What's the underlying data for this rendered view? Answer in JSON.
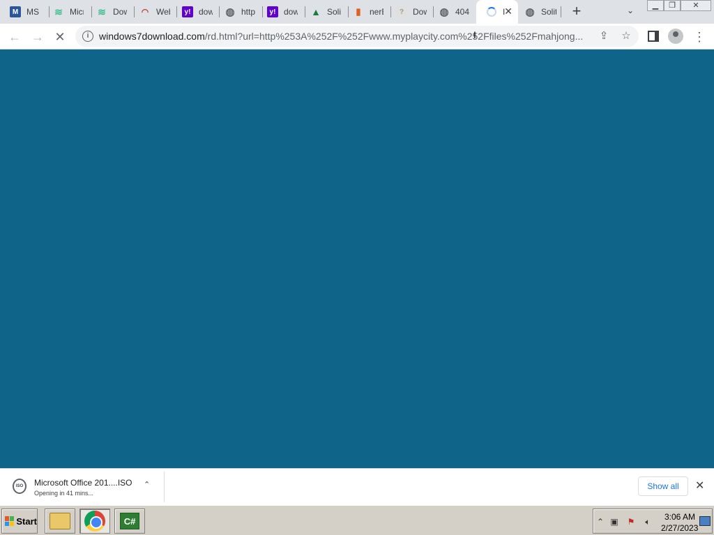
{
  "tabs": [
    {
      "title": "MS O",
      "icon": "M",
      "color": "#2b579a"
    },
    {
      "title": "Micr",
      "icon": "F",
      "color": "#3fbf8f"
    },
    {
      "title": "Dow",
      "icon": "F",
      "color": "#3fbf8f"
    },
    {
      "title": "Web",
      "icon": "W",
      "color": "#c0392b"
    },
    {
      "title": "dow",
      "icon": "y!",
      "color": "#6001d2"
    },
    {
      "title": "http",
      "icon": "globe",
      "color": "#5f6368"
    },
    {
      "title": "dow",
      "icon": "y!",
      "color": "#6001d2"
    },
    {
      "title": "Solit",
      "icon": "tree",
      "color": "#1e7a3c"
    },
    {
      "title": "nerE",
      "icon": "bars",
      "color": "#e06020"
    },
    {
      "title": "Dow",
      "icon": "?",
      "color": "#bdbdbd"
    },
    {
      "title": "404",
      "icon": "globe",
      "color": "#5f6368"
    },
    {
      "title": "I",
      "icon": "spinner",
      "color": "#1a73e8"
    },
    {
      "title": "Solit",
      "icon": "globe",
      "color": "#5f6368"
    }
  ],
  "toolbar": {
    "url_host": "windows7download.com",
    "url_path": "/rd.html?url=http%253A%252F%252Fwww.myplaycity.com%252Ffiles%252Fmahjong..."
  },
  "download": {
    "filename": "Microsoft Office 201....ISO",
    "status": "Opening in 41 mins...",
    "show_all": "Show all"
  },
  "taskbar": {
    "start_label": "Start",
    "time": "3:06 AM",
    "date": "2/27/2023"
  },
  "colors": {
    "page_background": "#0e6489",
    "accent": "#1a73e8"
  }
}
